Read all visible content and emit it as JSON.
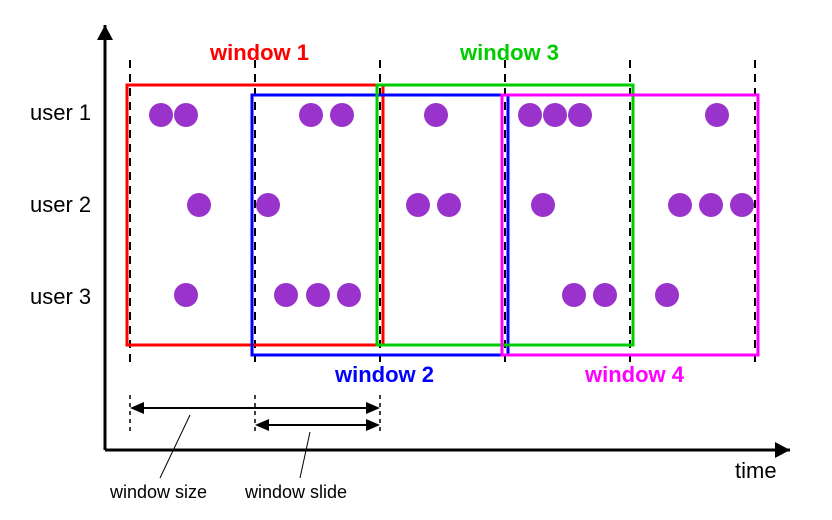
{
  "chart_data": {
    "type": "diagram",
    "title": "",
    "xlabel": "time",
    "users": [
      "user 1",
      "user 2",
      "user 3"
    ],
    "time_ticks": [
      0,
      1,
      2,
      3,
      4,
      5
    ],
    "windows": [
      {
        "name": "window 1",
        "start_tick": 0,
        "end_tick": 2,
        "color": "#ff0000"
      },
      {
        "name": "window 2",
        "start_tick": 1,
        "end_tick": 3,
        "color": "#0000ff"
      },
      {
        "name": "window 3",
        "start_tick": 2,
        "end_tick": 4,
        "color": "#00cc00"
      },
      {
        "name": "window 4",
        "start_tick": 3,
        "end_tick": 5,
        "color": "#ff00ff"
      }
    ],
    "window_size_ticks": 2,
    "window_slide_ticks": 1,
    "events": {
      "user 1": [
        0.25,
        0.45,
        1.45,
        1.7,
        2.45,
        3.2,
        3.4,
        3.6,
        4.7
      ],
      "user 2": [
        0.55,
        1.1,
        2.3,
        2.55,
        3.3,
        4.4,
        4.65,
        4.9
      ],
      "user 3": [
        0.45,
        1.25,
        1.5,
        1.75,
        3.55,
        3.8,
        4.3
      ]
    },
    "annotations": {
      "window_size_label": "window size",
      "window_slide_label": "window slide"
    }
  },
  "labels": {
    "user1": "user 1",
    "user2": "user 2",
    "user3": "user 3",
    "window1": "window 1",
    "window2": "window 2",
    "window3": "window 3",
    "window4": "window 4",
    "time": "time",
    "window_size": "window size",
    "window_slide": "window slide"
  },
  "colors": {
    "w1": "#ff0000",
    "w2": "#0000ff",
    "w3": "#00cc00",
    "w4": "#ff00ff",
    "event": "#9933cc"
  }
}
